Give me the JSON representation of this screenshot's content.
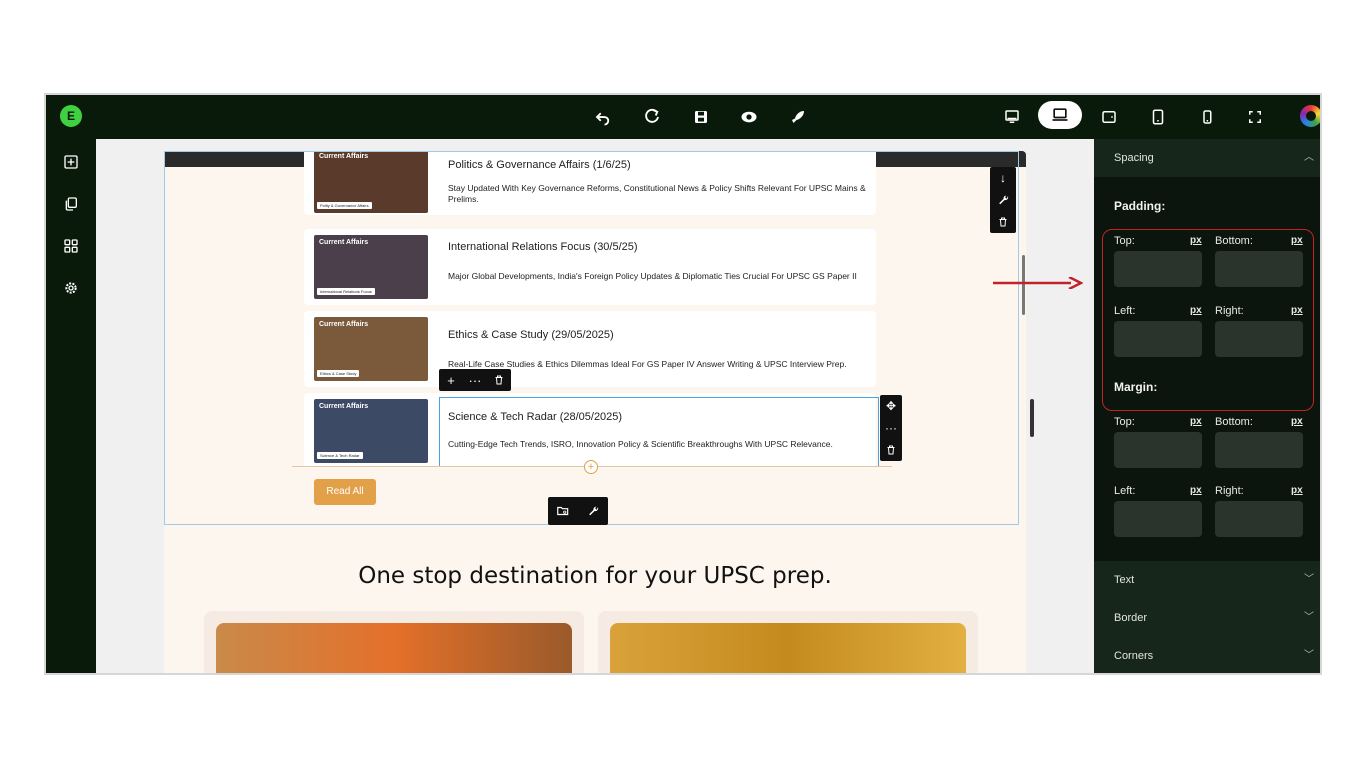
{
  "toolbar": {
    "logo": "E",
    "icons": [
      "undo-icon",
      "redo-icon",
      "save-icon",
      "preview-icon",
      "publish-icon"
    ],
    "devices": [
      "desktop-icon",
      "laptop-icon",
      "tablet-landscape-icon",
      "tablet-icon",
      "mobile-icon",
      "fullscreen-icon"
    ]
  },
  "rail": {
    "icons": [
      "add-element-icon",
      "pages-icon",
      "components-icon",
      "settings-icon"
    ]
  },
  "cards": [
    {
      "title": "Politics & Governance Affairs (1/6/25)",
      "desc": "Stay Updated With Key Governance Reforms, Constitutional News & Policy Shifts Relevant For UPSC Mains & Prelims.",
      "thumb_label": "Current Affairs",
      "thumb_caption": "Polity & Governance Affairs",
      "thumb_color": "#5a3a2a"
    },
    {
      "title": "International Relations Focus (30/5/25)",
      "desc": "Major Global Developments, India's Foreign Policy Updates & Diplomatic Ties Crucial For UPSC GS Paper II",
      "thumb_label": "Current Affairs",
      "thumb_caption": "International Relations Focus",
      "thumb_color": "#4a3f4a"
    },
    {
      "title": "Ethics & Case Study (29/05/2025)",
      "desc": "Real-Life Case Studies & Ethics Dilemmas Ideal For GS Paper IV Answer Writing & UPSC Interview Prep.",
      "thumb_label": "Current Affairs",
      "thumb_caption": "Ethics & Case Study",
      "thumb_color": "#7a5a3a"
    },
    {
      "title": "Science & Tech Radar (28/05/2025)",
      "desc": "Cutting-Edge Tech Trends, ISRO, Innovation Policy & Scientific Breakthroughs With UPSC Relevance.",
      "thumb_label": "Current Affairs",
      "thumb_caption": "Science & Tech Radar",
      "thumb_color": "#3c4a66"
    }
  ],
  "read_all": "Read All",
  "headline": "One stop destination for your UPSC prep.",
  "panel": {
    "spacing": "Spacing",
    "padding": "Padding:",
    "margin": "Margin:",
    "top": "Top:",
    "bottom": "Bottom:",
    "left": "Left:",
    "right": "Right:",
    "unit": "px",
    "sections": [
      "Text",
      "Border",
      "Corners"
    ]
  },
  "colors": {
    "accent": "#e2a049",
    "highlight": "#c0242a",
    "selection": "#4aa3df"
  }
}
